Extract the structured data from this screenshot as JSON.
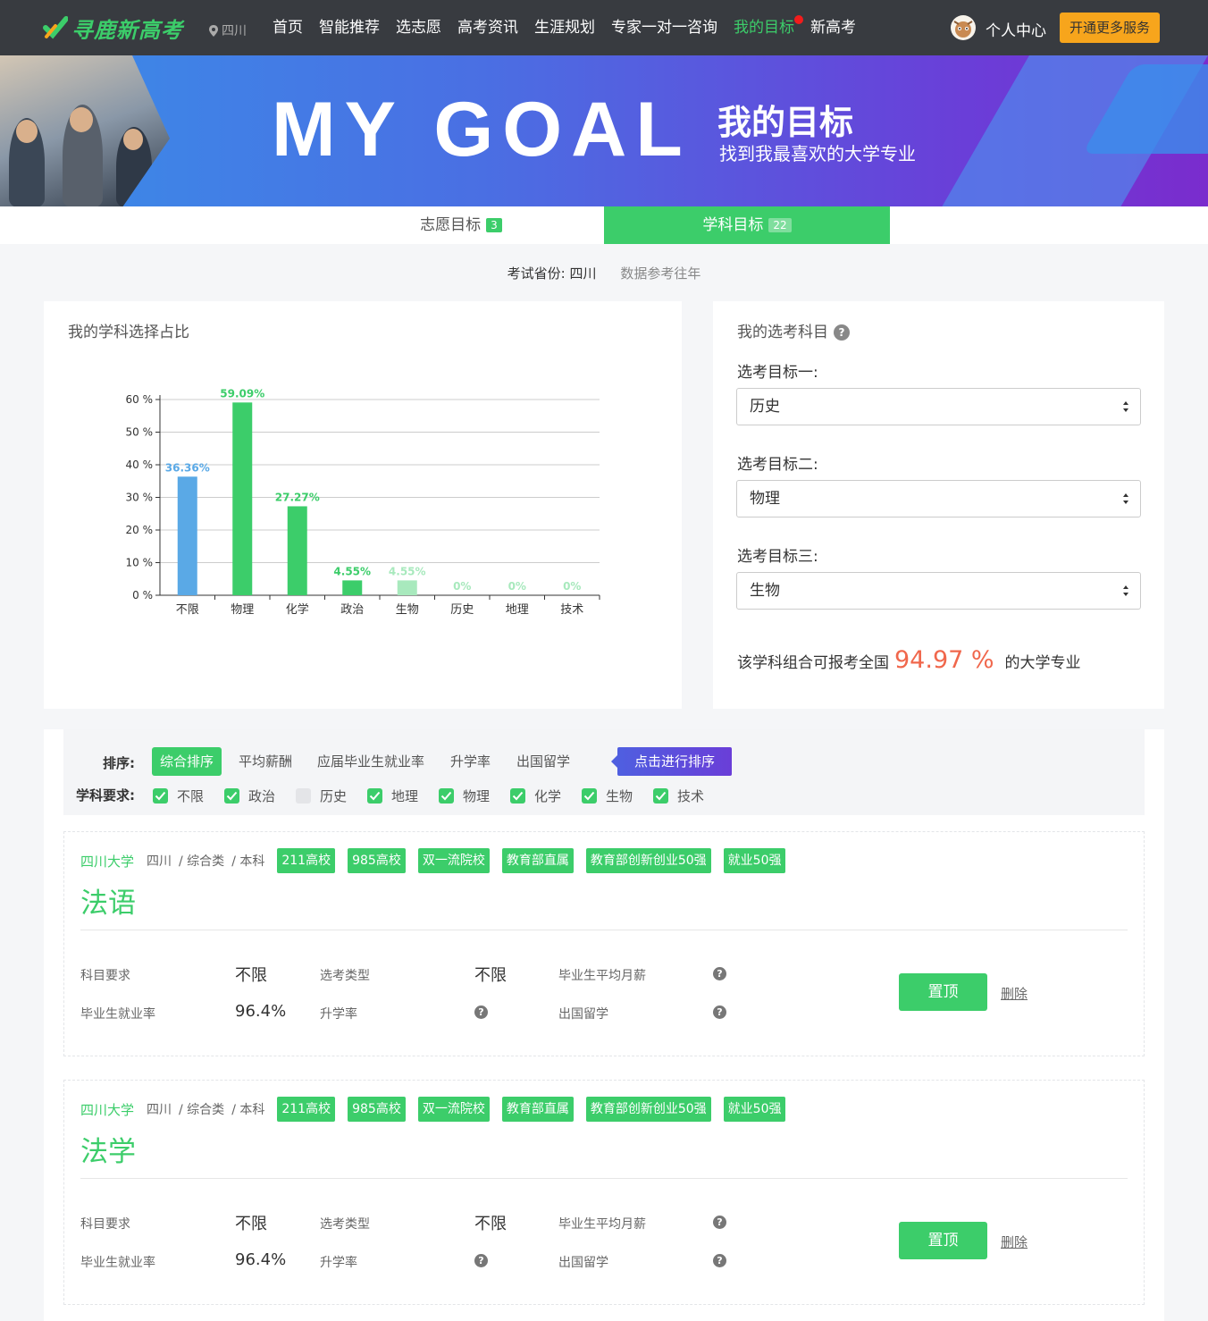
{
  "nav": {
    "logo_text": "寻鹿新高考",
    "location": "四川",
    "items": [
      "首页",
      "智能推荐",
      "选志愿",
      "高考资讯",
      "生涯规划",
      "专家一对一咨询",
      "我的目标",
      "新高考"
    ],
    "active_index": 6,
    "personal_center": "个人中心",
    "more_services": "开通更多服务"
  },
  "banner": {
    "big_text": "MY GOAL",
    "title": "我的目标",
    "subtitle": "找到我最喜欢的大学专业"
  },
  "tabs": [
    {
      "label": "志愿目标",
      "count": "3"
    },
    {
      "label": "学科目标",
      "count": "22"
    }
  ],
  "subinfo": {
    "province_label": "考试省份:",
    "province": "四川",
    "note": "数据参考往年"
  },
  "chart_panel": {
    "title": "我的学科选择占比"
  },
  "chart_data": {
    "type": "bar",
    "title": "我的学科选择占比",
    "categories": [
      "不限",
      "物理",
      "化学",
      "政治",
      "生物",
      "历史",
      "地理",
      "技术"
    ],
    "values": [
      36.36,
      59.09,
      27.27,
      4.55,
      4.55,
      0,
      0,
      0
    ],
    "value_labels": [
      "36.36%",
      "59.09%",
      "27.27%",
      "4.55%",
      "4.55%",
      "0%",
      "0%",
      "0%"
    ],
    "colors": [
      "#5aa9e6",
      "#3ccd6a",
      "#3ccd6a",
      "#3ccd6a",
      "#a8e9bd",
      "#a8e9bd",
      "#a8e9bd",
      "#a8e9bd"
    ],
    "label_colors": [
      "#5aa9e6",
      "#3ccd6a",
      "#3ccd6a",
      "#3ccd6a",
      "#a8e9bd",
      "#a8e9bd",
      "#a8e9bd",
      "#a8e9bd"
    ],
    "yticks": [
      "0 %",
      "10 %",
      "20 %",
      "30 %",
      "40 %",
      "50 %",
      "60 %"
    ],
    "ylim": [
      0,
      60
    ],
    "grid": true
  },
  "select_panel": {
    "title": "我的选考科目",
    "targets": [
      {
        "label": "选考目标一:",
        "value": "历史"
      },
      {
        "label": "选考目标二:",
        "value": "物理"
      },
      {
        "label": "选考目标三:",
        "value": "生物"
      }
    ],
    "ratio_prefix": "该学科组合可报考全国",
    "ratio_value": "94.97 %",
    "ratio_suffix": "的大学专业"
  },
  "filter": {
    "sort_label": "排序:",
    "sort_options": [
      "综合排序",
      "平均薪酬",
      "应届毕业生就业率",
      "升学率",
      "出国留学"
    ],
    "sort_active": 0,
    "sort_tip": "点击进行排序",
    "subject_label": "学科要求:",
    "subjects": [
      {
        "label": "不限",
        "checked": true
      },
      {
        "label": "政治",
        "checked": true
      },
      {
        "label": "历史",
        "checked": false
      },
      {
        "label": "地理",
        "checked": true
      },
      {
        "label": "物理",
        "checked": true
      },
      {
        "label": "化学",
        "checked": true
      },
      {
        "label": "生物",
        "checked": true
      },
      {
        "label": "技术",
        "checked": true
      }
    ]
  },
  "cards": [
    {
      "university": "四川大学",
      "province": "四川",
      "type": "/ 综合类",
      "level": "/ 本科",
      "tags": [
        "211高校",
        "985高校",
        "双一流院校",
        "教育部直属",
        "教育部创新创业50强",
        "就业50强"
      ],
      "major": "法语",
      "subject_req_label": "科目要求",
      "subject_req": "不限",
      "select_type_label": "选考类型",
      "select_type": "不限",
      "salary_label": "毕业生平均月薪",
      "employment_label": "毕业生就业率",
      "employment": "96.4%",
      "further_label": "升学率",
      "abroad_label": "出国留学",
      "pin": "置顶",
      "delete": "删除"
    },
    {
      "university": "四川大学",
      "province": "四川",
      "type": "/ 综合类",
      "level": "/ 本科",
      "tags": [
        "211高校",
        "985高校",
        "双一流院校",
        "教育部直属",
        "教育部创新创业50强",
        "就业50强"
      ],
      "major": "法学",
      "subject_req_label": "科目要求",
      "subject_req": "不限",
      "select_type_label": "选考类型",
      "select_type": "不限",
      "salary_label": "毕业生平均月薪",
      "employment_label": "毕业生就业率",
      "employment": "96.4%",
      "further_label": "升学率",
      "abroad_label": "出国留学",
      "pin": "置顶",
      "delete": "删除"
    }
  ]
}
